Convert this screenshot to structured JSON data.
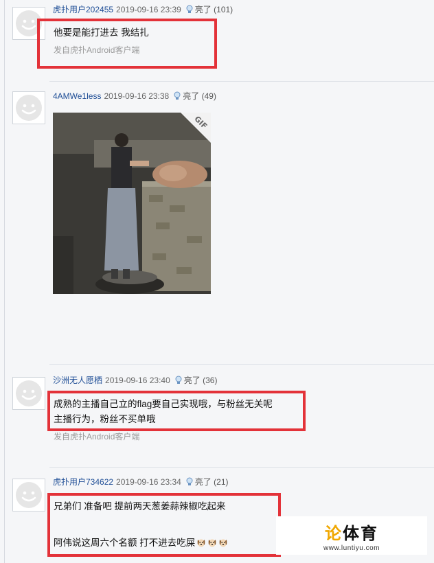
{
  "posts": [
    {
      "user": "虎扑用户202455",
      "time": "2019-09-16 23:39",
      "light_label": "亮了",
      "light_count": "(101)",
      "lines": [
        "他要是能打进去 我结扎"
      ],
      "source": "发自虎扑Android客户端"
    },
    {
      "user": "4AMWe1less",
      "time": "2019-09-16 23:38",
      "light_label": "亮了",
      "light_count": "(49)",
      "gif_badge": "GIF"
    },
    {
      "user": "沙洲无人愿栖",
      "time": "2019-09-16 23:40",
      "light_label": "亮了",
      "light_count": "(36)",
      "lines": [
        "成熟的主播自己立的flag要自己实现哦，与粉丝无关呢",
        "主播行为，粉丝不买单哦"
      ],
      "source": "发自虎扑Android客户端"
    },
    {
      "user": "虎扑用户734622",
      "time": "2019-09-16 23:34",
      "light_label": "亮了",
      "light_count": "(21)",
      "lines": [
        "兄弟们 准备吧 提前两天葱姜蒜辣椒吃起来",
        "阿伟说这周六个名额 打不进去吃屎"
      ]
    }
  ],
  "watermark": {
    "logo_accent": "论",
    "logo_rest": "体育",
    "url": "www.luntiyu.com"
  },
  "colors": {
    "username": "#1f4e96",
    "highlight_box": "#e33239",
    "background": "#f5f6f8"
  },
  "icons": [
    "avatar-placeholder-icon",
    "lightbulb-icon",
    "dog-emoji-icon"
  ]
}
